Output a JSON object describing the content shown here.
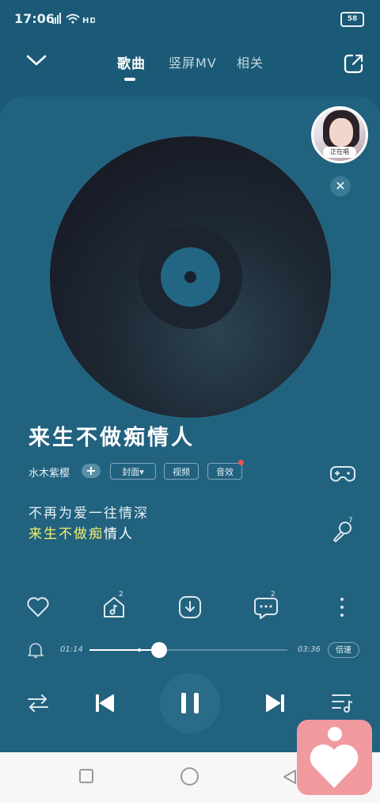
{
  "status": {
    "time": "17:06",
    "signal": "4G HD",
    "battery": "58"
  },
  "tabs": [
    {
      "label": "歌曲"
    },
    {
      "label": "竖屏MV"
    },
    {
      "label": "相关"
    }
  ],
  "avatar": {
    "tag": "正在唱"
  },
  "song": {
    "title": "来生不做痴情人",
    "artist": "水木紫樱"
  },
  "pills": {
    "cover": "封面",
    "video": "视频",
    "effect": "音效"
  },
  "lyrics": {
    "line1": "不再为爱一往情深",
    "line2_highlight": "来生不做痴",
    "line2_rest": "情人"
  },
  "actions": {
    "share_count": "2",
    "comment_count": "2",
    "mic_count": "7"
  },
  "progress": {
    "current": "01:14",
    "total": "03:36",
    "fraction": 0.35,
    "speed_label": "倍速"
  },
  "colors": {
    "accent": "#f5ee6a",
    "background": "#1a5a76",
    "app_icon": "#f09aa0"
  }
}
